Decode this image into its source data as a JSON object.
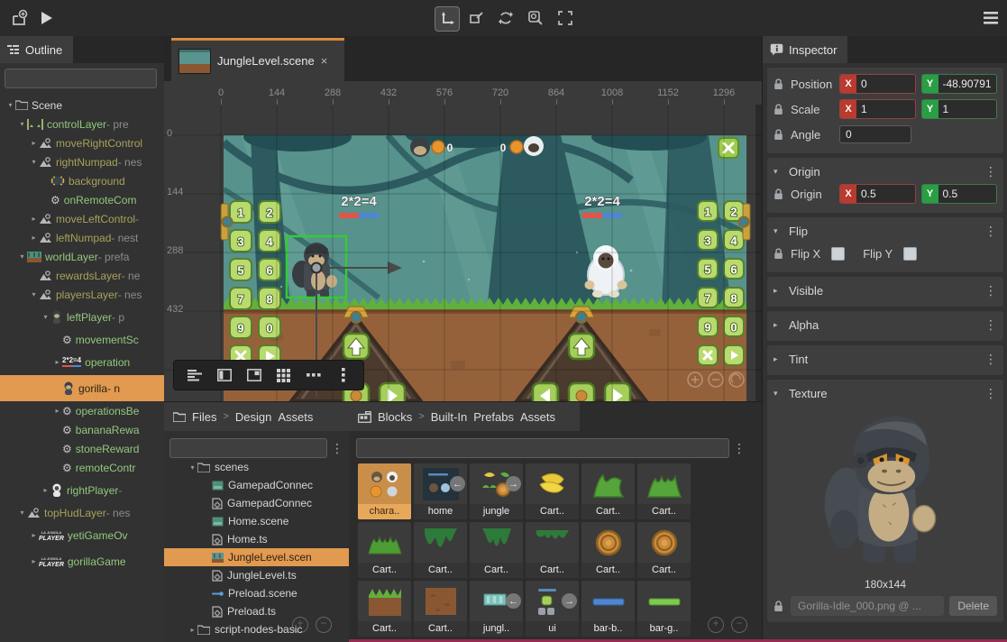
{
  "topbar": {
    "tools": [
      "move",
      "rect-transform",
      "rotate",
      "zoom-region",
      "frame-select"
    ],
    "active_tool": "move"
  },
  "outline": {
    "tab": "Outline",
    "search_placeholder": "",
    "eq_icon_text": "2*2=4",
    "player_logo_top": "LA JUNGLA",
    "player_logo_text": "PLAYER",
    "items": [
      {
        "name": "Scene",
        "suffix": "",
        "icon": "folder",
        "arrow": "down",
        "color": "white",
        "depth": 0
      },
      {
        "name": "controlLayer",
        "suffix": " - pre",
        "icon": "layer-strip",
        "arrow": "down",
        "color": "green",
        "depth": 1
      },
      {
        "name": "moveRightControl",
        "suffix": "",
        "icon": "nested",
        "arrow": "right",
        "color": "olive",
        "depth": 2
      },
      {
        "name": "rightNumpad",
        "suffix": " - nes",
        "icon": "nested",
        "arrow": "down",
        "color": "olive",
        "depth": 2
      },
      {
        "name": "background",
        "suffix": "",
        "icon": "frame",
        "arrow": "",
        "color": "olive",
        "depth": 3
      },
      {
        "name": "onRemoteCom",
        "suffix": "",
        "icon": "gear",
        "arrow": "",
        "color": "green",
        "depth": 3
      },
      {
        "name": "moveLeftControl",
        "suffix": " -",
        "icon": "nested",
        "arrow": "right",
        "color": "olive",
        "depth": 2
      },
      {
        "name": "leftNumpad",
        "suffix": " - nest",
        "icon": "nested",
        "arrow": "right",
        "color": "olive",
        "depth": 2
      },
      {
        "name": "worldLayer",
        "suffix": " - prefa",
        "icon": "world",
        "arrow": "down",
        "color": "green",
        "depth": 1
      },
      {
        "name": "rewardsLayer",
        "suffix": " - ne",
        "icon": "nested",
        "arrow": "",
        "color": "olive",
        "depth": 2
      },
      {
        "name": "playersLayer",
        "suffix": " - nes",
        "icon": "nested",
        "arrow": "down",
        "color": "olive",
        "depth": 2
      },
      {
        "name": "leftPlayer",
        "suffix": " - p",
        "icon": "gorilla-mini",
        "arrow": "down",
        "color": "green",
        "depth": 3
      },
      {
        "name": "movementSc",
        "suffix": "",
        "icon": "gear",
        "arrow": "",
        "color": "green",
        "depth": 4
      },
      {
        "name": "operation",
        "suffix": "",
        "icon": "eq",
        "arrow": "right",
        "color": "green",
        "depth": 4
      },
      {
        "name": "gorilla",
        "suffix": " - n",
        "icon": "gorilla-mini",
        "arrow": "",
        "color": "dark",
        "depth": 4,
        "selected": true
      },
      {
        "name": "operationsBe",
        "suffix": "",
        "icon": "gear",
        "arrow": "right",
        "color": "green",
        "depth": 4
      },
      {
        "name": "bananaRewa",
        "suffix": "",
        "icon": "gear",
        "arrow": "",
        "color": "green",
        "depth": 4
      },
      {
        "name": "stoneReward",
        "suffix": "",
        "icon": "gear",
        "arrow": "",
        "color": "green",
        "depth": 4
      },
      {
        "name": "remoteContr",
        "suffix": "",
        "icon": "gear",
        "arrow": "",
        "color": "green",
        "depth": 4
      },
      {
        "name": "rightPlayer",
        "suffix": " -",
        "icon": "yeti-mini",
        "arrow": "right",
        "color": "green",
        "depth": 3
      },
      {
        "name": "topHudLayer",
        "suffix": " - nes",
        "icon": "nested",
        "arrow": "down",
        "color": "olive",
        "depth": 1
      },
      {
        "name": "yetiGameOv",
        "suffix": "",
        "icon": "player-logo",
        "arrow": "right",
        "color": "green",
        "depth": 2
      },
      {
        "name": "gorillaGame",
        "suffix": "",
        "icon": "player-logo",
        "arrow": "right",
        "color": "green",
        "depth": 2
      }
    ]
  },
  "scene": {
    "tab_title": "JungleLevel.scene",
    "close_glyph": "×",
    "ruler_x": [
      "0",
      "144",
      "288",
      "432",
      "576",
      "720",
      "864",
      "1008",
      "1152",
      "1296"
    ],
    "ruler_y": [
      "0",
      "144",
      "288",
      "432"
    ],
    "hud_left_score": "0",
    "hud_right_score": "0",
    "eq_left": "2*2=4",
    "eq_right": "2*2=4",
    "numpad": [
      "1",
      "2",
      "3",
      "4",
      "5",
      "6",
      "7",
      "8",
      "9",
      "0"
    ],
    "numpad_extra": [
      "x",
      "play"
    ]
  },
  "files": {
    "tab": "Files",
    "crumb_sep": ">",
    "crumbs": [
      "Design",
      "Assets"
    ],
    "search_placeholder": "",
    "tree": [
      {
        "name": "scenes",
        "icon": "folder",
        "arrow": "down",
        "depth": 1
      },
      {
        "name": "GamepadConnec",
        "icon": "scene",
        "depth": 2
      },
      {
        "name": "GamepadConnec",
        "icon": "ts",
        "depth": 2
      },
      {
        "name": "Home.scene",
        "icon": "scene",
        "depth": 2
      },
      {
        "name": "Home.ts",
        "icon": "ts",
        "depth": 2
      },
      {
        "name": "JungleLevel.scen",
        "icon": "scene-jungle",
        "depth": 2,
        "selected": true
      },
      {
        "name": "JungleLevel.ts",
        "icon": "ts",
        "depth": 2
      },
      {
        "name": "Preload.scene",
        "icon": "preload",
        "depth": 2
      },
      {
        "name": "Preload.ts",
        "icon": "ts",
        "depth": 2
      },
      {
        "name": "script-nodes-basic",
        "icon": "folder",
        "arrow": "right",
        "depth": 1
      }
    ]
  },
  "blocks": {
    "tab": "Blocks",
    "crumb_sep": ">",
    "crumbs": [
      "Built-In",
      "Prefabs",
      "Assets"
    ],
    "search_placeholder": "",
    "assets": [
      {
        "label": "chara..",
        "thumb": "characters",
        "selected": true
      },
      {
        "label": "home",
        "thumb": "home",
        "overlay": "left"
      },
      {
        "label": "jungle",
        "thumb": "jungle",
        "overlay": "right"
      },
      {
        "label": "Cart..",
        "thumb": "banana"
      },
      {
        "label": "Cart..",
        "thumb": "grass-tuft"
      },
      {
        "label": "Cart..",
        "thumb": "grass-clump"
      },
      {
        "label": "Cart..",
        "thumb": "grass-spike"
      },
      {
        "label": "Cart..",
        "thumb": "moss-a"
      },
      {
        "label": "Cart..",
        "thumb": "moss-b"
      },
      {
        "label": "Cart..",
        "thumb": "moss-c"
      },
      {
        "label": "Cart..",
        "thumb": "log"
      },
      {
        "label": "Cart..",
        "thumb": "log"
      },
      {
        "label": "Cart..",
        "thumb": "grass-dirt"
      },
      {
        "label": "Cart..",
        "thumb": "dirt"
      },
      {
        "label": "jungl..",
        "thumb": "tile",
        "overlay": "left"
      },
      {
        "label": "ui",
        "thumb": "ui",
        "overlay": "right"
      },
      {
        "label": "bar-b..",
        "thumb": "bar-blue"
      },
      {
        "label": "bar-g..",
        "thumb": "bar-green"
      }
    ]
  },
  "inspector": {
    "tab": "Inspector",
    "x_badge": "X",
    "y_badge": "Y",
    "rows": [
      {
        "label": "Position",
        "x": "0",
        "y": "-48.90791"
      },
      {
        "label": "Scale",
        "x": "1",
        "y": "1"
      }
    ],
    "angle_label": "Angle",
    "angle_value": "0",
    "origin_section": "Origin",
    "origin_label": "Origin",
    "origin_x": "0.5",
    "origin_y": "0.5",
    "flip_section": "Flip",
    "flip_x_label": "Flip X",
    "flip_y_label": "Flip Y",
    "collapsed_sections": [
      "Visible",
      "Alpha",
      "Tint"
    ],
    "texture_section": "Texture",
    "texture_size": "180x144",
    "texture_file": "Gorilla-Idle_000.png @ ...",
    "delete_label": "Delete"
  },
  "colors": {
    "accent_orange": "#e19a50",
    "tab_accent": "#d98b3c",
    "x_red": "#b93a2e",
    "y_green": "#2a9e44",
    "bar_red": "#e05548",
    "bar_blue": "#4f86d0",
    "tile_green": "#b9da6e",
    "prefab_green": "#93c87d",
    "nested_olive": "#a8a25a",
    "selection_green": "#35cb35",
    "bottom_line": "#962b52"
  }
}
